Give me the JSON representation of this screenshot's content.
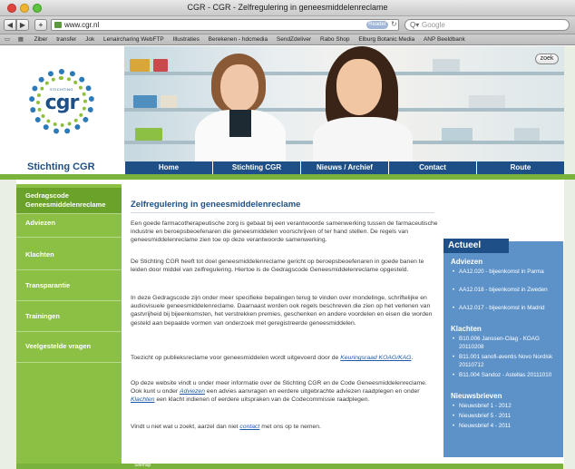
{
  "browser": {
    "window_title": "CGR - CGR - Zelfregulering in geneesmiddelenreclame",
    "url": "www.cgr.nl",
    "reader_label": "Reader",
    "search_placeholder": "Google",
    "bookmarks": [
      "Ziber",
      "transfer",
      "Jok",
      "Lenaircharing WebFTP",
      "Illustraties",
      "Berekenen - hdcmedia",
      "SendZdeliver",
      "Rabo Shop",
      "Elburg Botanic Media",
      "ANP Beeldbank"
    ]
  },
  "site": {
    "name": "Stichting CGR",
    "logo_text": "cgr",
    "logo_small": "STICHTING",
    "search_button": "zoek"
  },
  "topnav": [
    {
      "label": "Home"
    },
    {
      "label": "Stichting CGR"
    },
    {
      "label": "Nieuws / Archief"
    },
    {
      "label": "Contact"
    },
    {
      "label": "Route"
    }
  ],
  "sidebar": [
    {
      "label": "Gedragscode",
      "label2": "Geneesmiddelenreclame"
    },
    {
      "label": "Adviezen"
    },
    {
      "label": "Klachten"
    },
    {
      "label": "Transparantie"
    },
    {
      "label": "Trainingen"
    },
    {
      "label": "Veelgestelde vragen"
    }
  ],
  "main": {
    "title": "Zelfregulering in geneesmiddelenreclame",
    "p1": "Een goede farmacotherapeutische zorg is gebaat bij een verantwoorde samenwerking tussen de farmaceutische industrie en beroepsbeoefenaren die geneesmiddelen voorschrijven of ter hand stellen. De regels van geneesmiddelenreclame zien toe op deze verantwoorde samenwerking.",
    "p2": "De Stichting CGR heeft tot doel geneesmiddelenreclame gericht op beroepsbeoefenaren in goede banen te leiden door middel van zelfregulering. Hiertoe is de Gedragscode Geneesmiddelenreclame opgesteld.",
    "p3": "In deze Gedragscode zijn onder meer specifieke bepalingen terug te vinden over mondelinge, schriftelijke en audiovisuele geneesmiddelenreclame. Daarnaast worden ook regels beschreven die zien op het verlenen van gastvrijheid bij bijeenkomsten, het verstrekken premies, geschenken en andere voordelen en eisen die worden gesteld aan bepaalde vormen van onderzoek met geregistreerde geneesmiddelen.",
    "p4_pre": "Toezicht op publieksreclame voor geneesmiddelen wordt uitgevoerd door de ",
    "p4_link": "Keuringsraad KOAG/KAG",
    "p4_post": ".",
    "p5_a": "Op deze website vindt u onder meer informatie over de Stichting CGR en de Code Geneesmiddelenreclame. Ook kunt u onder ",
    "p5_link1": "Adviezen",
    "p5_b": " een advies aanvragen en eerdere uitgebrachte adviezen raadplegen en onder ",
    "p5_link2": "Klachten",
    "p5_c": " een klacht indienen of eerdere uitspraken van de Codecommissie raadplegen.",
    "p6_pre": "Vindt u niet wat u zoekt, aarzel dan niet ",
    "p6_link": "contact",
    "p6_post": " met ons op te nemen."
  },
  "actueel": {
    "title": "Actueel",
    "sections": [
      {
        "heading": "Adviezen",
        "items": [
          "AA12.020 - bijeenkomst in Parma",
          "AA12.018 - bijeenkomst in Zweden",
          "AA12.017 - bijeenkomst in Madrid"
        ]
      },
      {
        "heading": "Klachten",
        "items": [
          "B10.006 Janssen-Cilag - KOAG 20110208",
          "B11.001 sanofi-aventis Novo Nordisk 20110712",
          "B11.004 Sandoz - Astellas 20111010"
        ]
      },
      {
        "heading": "Nieuwsbrieven",
        "items": [
          "Nieuwsbrief 1 - 2012",
          "Nieuwsbrief 5 - 2011",
          "Nieuwsbrief 4 - 2011"
        ]
      }
    ]
  },
  "footer": {
    "label": "Sitemap"
  },
  "colors": {
    "brand_blue": "#1e4f86",
    "brand_green": "#8cc045",
    "panel_blue": "#5d92c9"
  }
}
